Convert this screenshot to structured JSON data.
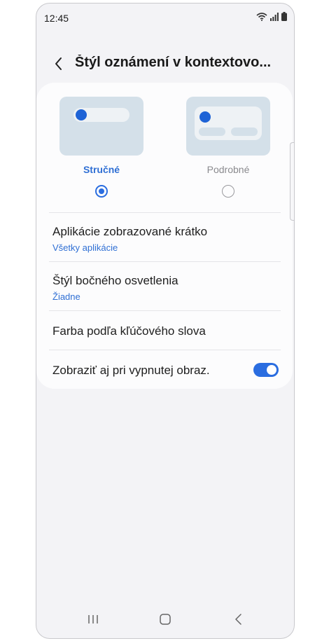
{
  "status": {
    "time": "12:45",
    "icons": [
      "wifi-icon",
      "signal-icon",
      "battery-icon"
    ]
  },
  "header": {
    "title": "Štýl oznámení v kontextovo..."
  },
  "options": [
    {
      "label": "Stručné",
      "selected": true
    },
    {
      "label": "Podrobné",
      "selected": false
    }
  ],
  "settings": {
    "apps": {
      "title": "Aplikácie zobrazované krátko",
      "value": "Všetky aplikácie"
    },
    "edge": {
      "title": "Štýl bočného osvetlenia",
      "value": "Žiadne"
    },
    "keyword": {
      "title": "Farba podľa kľúčového slova"
    },
    "screen_off": {
      "title": "Zobraziť aj pri vypnutej obraz.",
      "enabled": true
    }
  },
  "colors": {
    "accent": "#2a6de0",
    "background": "#f3f3f6",
    "card": "#fcfcfd"
  }
}
